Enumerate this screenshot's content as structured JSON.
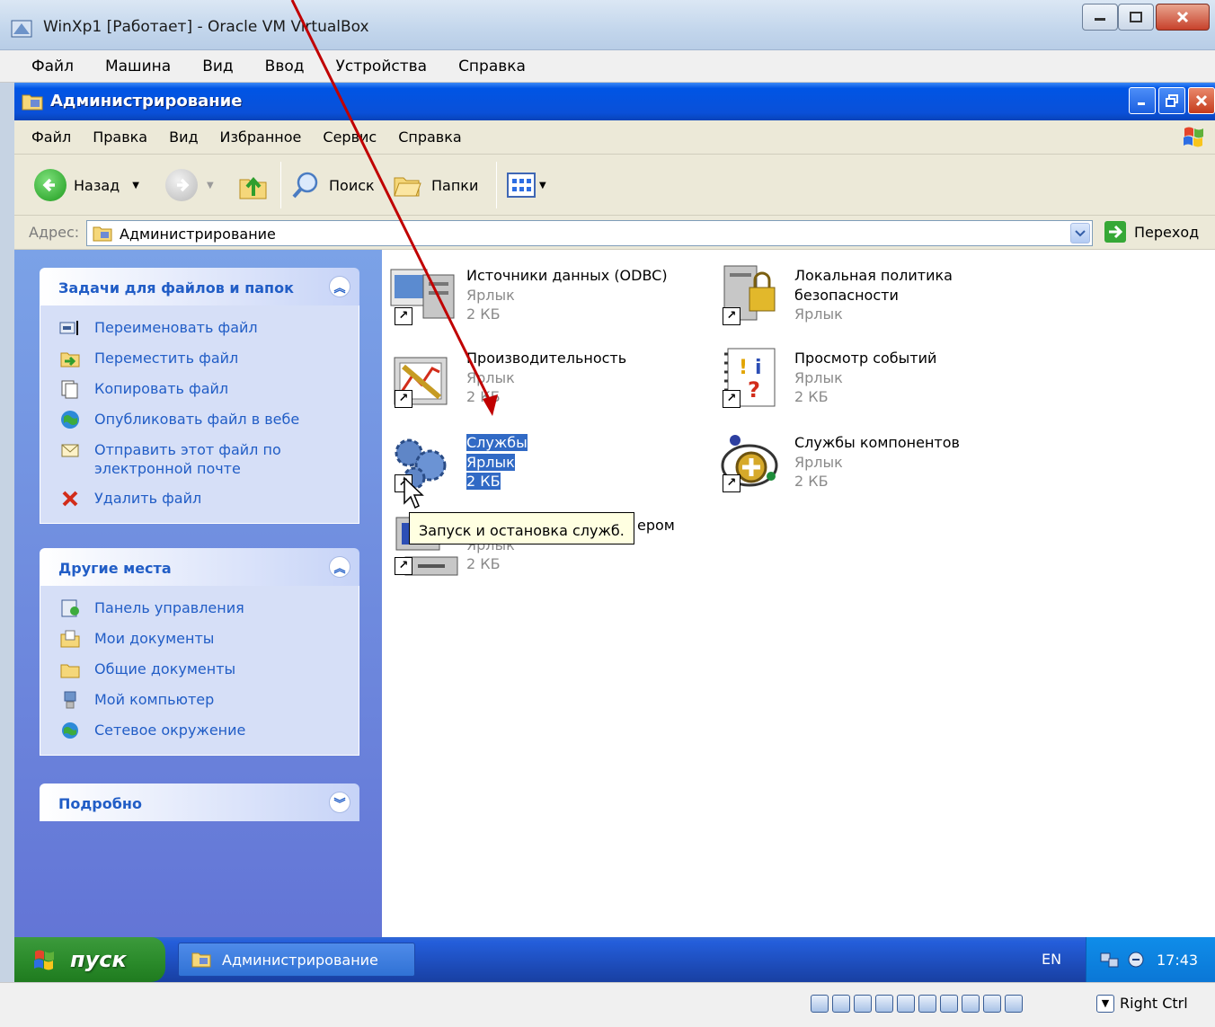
{
  "host": {
    "title": "WinXp1 [Работает] - Oracle VM VirtualBox",
    "menu": [
      "Файл",
      "Машина",
      "Вид",
      "Ввод",
      "Устройства",
      "Справка"
    ],
    "status": {
      "host_key": "Right Ctrl"
    }
  },
  "explorer": {
    "title": "Администрирование",
    "menu": [
      "Файл",
      "Правка",
      "Вид",
      "Избранное",
      "Сервис",
      "Справка"
    ],
    "toolbar": {
      "back_label": "Назад",
      "search_label": "Поиск",
      "folders_label": "Папки"
    },
    "address": {
      "label": "Адрес:",
      "value": "Администрирование",
      "go_label": "Переход"
    },
    "task_pane": {
      "file_tasks": {
        "title": "Задачи для файлов и папок",
        "items": [
          {
            "label": "Переименовать файл",
            "icon": "rename-icon"
          },
          {
            "label": "Переместить файл",
            "icon": "move-icon"
          },
          {
            "label": "Копировать файл",
            "icon": "copy-icon"
          },
          {
            "label": "Опубликовать файл в вебе",
            "icon": "publish-web-icon"
          },
          {
            "label": "Отправить этот файл по электронной почте",
            "icon": "email-icon"
          },
          {
            "label": "Удалить файл",
            "icon": "delete-icon"
          }
        ]
      },
      "other_places": {
        "title": "Другие места",
        "items": [
          {
            "label": "Панель управления",
            "icon": "control-panel-icon"
          },
          {
            "label": "Мои документы",
            "icon": "my-documents-icon"
          },
          {
            "label": "Общие документы",
            "icon": "shared-documents-icon"
          },
          {
            "label": "Мой компьютер",
            "icon": "my-computer-icon"
          },
          {
            "label": "Сетевое окружение",
            "icon": "network-places-icon"
          }
        ]
      },
      "details": {
        "title": "Подробно"
      }
    },
    "files": [
      {
        "name": "Источники данных (ODBC)",
        "type": "Ярлык",
        "size": "2 КБ",
        "icon": "odbc-icon"
      },
      {
        "name": "Локальная политика безопасности",
        "type": "Ярлык",
        "size": "",
        "icon": "security-policy-icon"
      },
      {
        "name": "Производительность",
        "type": "Ярлык",
        "size": "2 КБ",
        "icon": "performance-icon"
      },
      {
        "name": "Просмотр событий",
        "type": "Ярлык",
        "size": "2 КБ",
        "icon": "event-viewer-icon"
      },
      {
        "name": "Службы",
        "type": "Ярлык",
        "size": "2 КБ",
        "icon": "services-icon",
        "selected": true
      },
      {
        "name": "Службы компонентов",
        "type": "Ярлык",
        "size": "2 КБ",
        "icon": "component-services-icon"
      },
      {
        "name_tail": "ером",
        "type": "Ярлык",
        "size": "2 КБ",
        "icon": "computer-management-icon"
      }
    ],
    "tooltip": "Запуск и остановка служб."
  },
  "taskbar": {
    "start_label": "пуск",
    "task_button": "Администрирование",
    "language": "EN",
    "clock": "17:43"
  },
  "colors": {
    "xp_title_blue": "#0055e5",
    "selection": "#316ac5",
    "task_link": "#215dc6",
    "annotation_arrow": "#c00000"
  }
}
